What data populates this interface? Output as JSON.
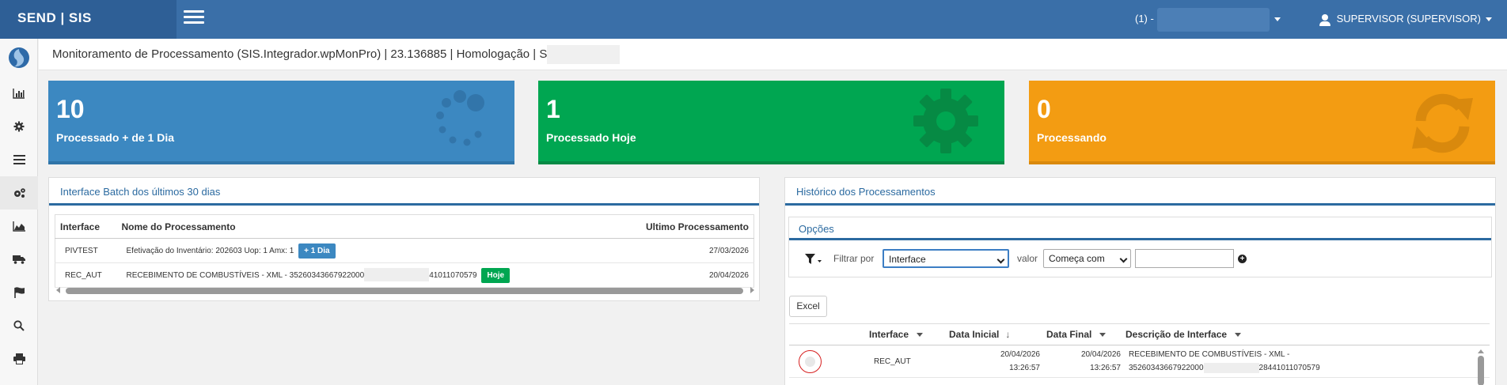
{
  "topbar": {
    "brand": "SEND | SIS",
    "company_prefix": "(1) -",
    "user_label": "SUPERVISOR (SUPERVISOR)"
  },
  "sidebar": {
    "items": [
      {
        "icon": "bar-chart-icon"
      },
      {
        "icon": "gear-icon"
      },
      {
        "icon": "list-icon"
      },
      {
        "icon": "gears-icon"
      },
      {
        "icon": "area-chart-icon"
      },
      {
        "icon": "truck-icon"
      },
      {
        "icon": "flag-icon"
      },
      {
        "icon": "search-icon"
      },
      {
        "icon": "print-icon"
      }
    ]
  },
  "header": {
    "title": "Monitoramento de Processamento (SIS.Integrador.wpMonPro) | 23.136885 | Homologação | S"
  },
  "tiles": [
    {
      "value": "10",
      "label": "Processado + de 1 Dia",
      "icon": "spinner-icon",
      "color": "#3c88c1"
    },
    {
      "value": "1",
      "label": "Processado Hoje",
      "icon": "gear-icon",
      "color": "#00a651"
    },
    {
      "value": "0",
      "label": "Processando",
      "icon": "refresh-icon",
      "color": "#f39c12"
    }
  ],
  "batch_panel": {
    "title": "Interface Batch dos últimos 30 dias",
    "columns": [
      "Interface",
      "Nome do Processamento",
      "Ultimo Processamento"
    ],
    "rows": [
      {
        "interface": "PIVTEST",
        "name": "Efetivação do Inventário: 202603 Uop: 1 Amx: 1",
        "name_suffix": "",
        "badge": "+ 1 Dia",
        "last": "27/03/2026"
      },
      {
        "interface": "REC_AUT",
        "name": "RECEBIMENTO DE COMBUSTÍVEIS - XML - 35260343667922000⁠",
        "name_suffix": "41011070579",
        "badge": "Hoje",
        "last": "20/04/2026"
      }
    ]
  },
  "history_panel": {
    "title": "Histórico dos Processamentos",
    "options_title": "Opções",
    "filter_label": "Filtrar por",
    "filter_field": "Interface",
    "value_label": "valor",
    "operator": "Começa com",
    "filter_value": "",
    "excel_label": "Excel",
    "columns": [
      "Interface",
      "Data Inicial",
      "Data Final",
      "Descrição de Interface"
    ],
    "rows": [
      {
        "interface": "REC_AUT",
        "start_date": "20/04/2026",
        "start_time": "13:26:57",
        "end_date": "20/04/2026",
        "end_time": "13:26:57",
        "desc_line1": "RECEBIMENTO DE COMBUSTÍVEIS - XML -",
        "desc_line2_a": "35260343667922000",
        "desc_line2_b": "28441011070579"
      }
    ]
  }
}
